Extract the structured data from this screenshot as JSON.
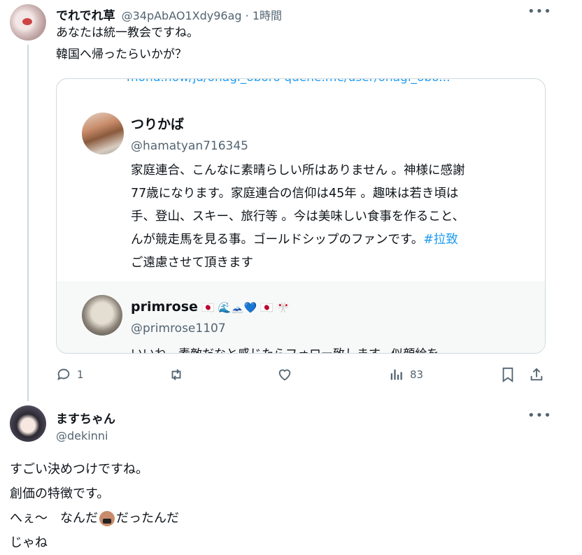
{
  "tweet1": {
    "display_name": "でれでれ草",
    "handle": "@34pAbAO1Xdy96ag",
    "time": "1時間",
    "separator": "·",
    "text": "あなたは統一教会ですね。\n韓国へ帰ったらいかが？",
    "card": {
      "top_link": "mond.how/ja/onagi_oboro   quene.me/user/onagi_obo...",
      "profile": {
        "name": "つりかば",
        "handle": "@hamatyan716345",
        "bio_lines": [
          "家庭連合、こんなに素晴らしい所はありません 。神様に感謝",
          "77歳になります。家庭連合の信仰は45年 。趣味は若き頃は",
          "手、登山、スキー、旅行等 。今は美味しい食事を作ること、",
          "んが競走馬を見る事。ゴールドシップのファンです。",
          "ご遠慮させて頂きます"
        ],
        "bio_hashtag": "#拉致"
      },
      "sub_profile": {
        "name": "primrose",
        "emoji": "🇯🇵 🌊🗻💙 🇯🇵 🎌",
        "handle": "@primrose1107",
        "cut_text": "いいね、素敵だなと感じたらフォロー致します。似顔絵を"
      }
    },
    "actions": {
      "reply_count": "1",
      "retweet_count": "",
      "like_count": "",
      "views_count": "83"
    }
  },
  "tweet2": {
    "display_name": "ますちゃん",
    "handle": "@dekinni",
    "text_lines": [
      "すごい決めつけですね。",
      "創価の特徴です。",
      "へぇ～　なんだ",
      "だったんだ",
      "じゃね"
    ]
  },
  "colors": {
    "link": "#1d9bf0",
    "secondary": "#536471",
    "border": "#cfd9de"
  }
}
